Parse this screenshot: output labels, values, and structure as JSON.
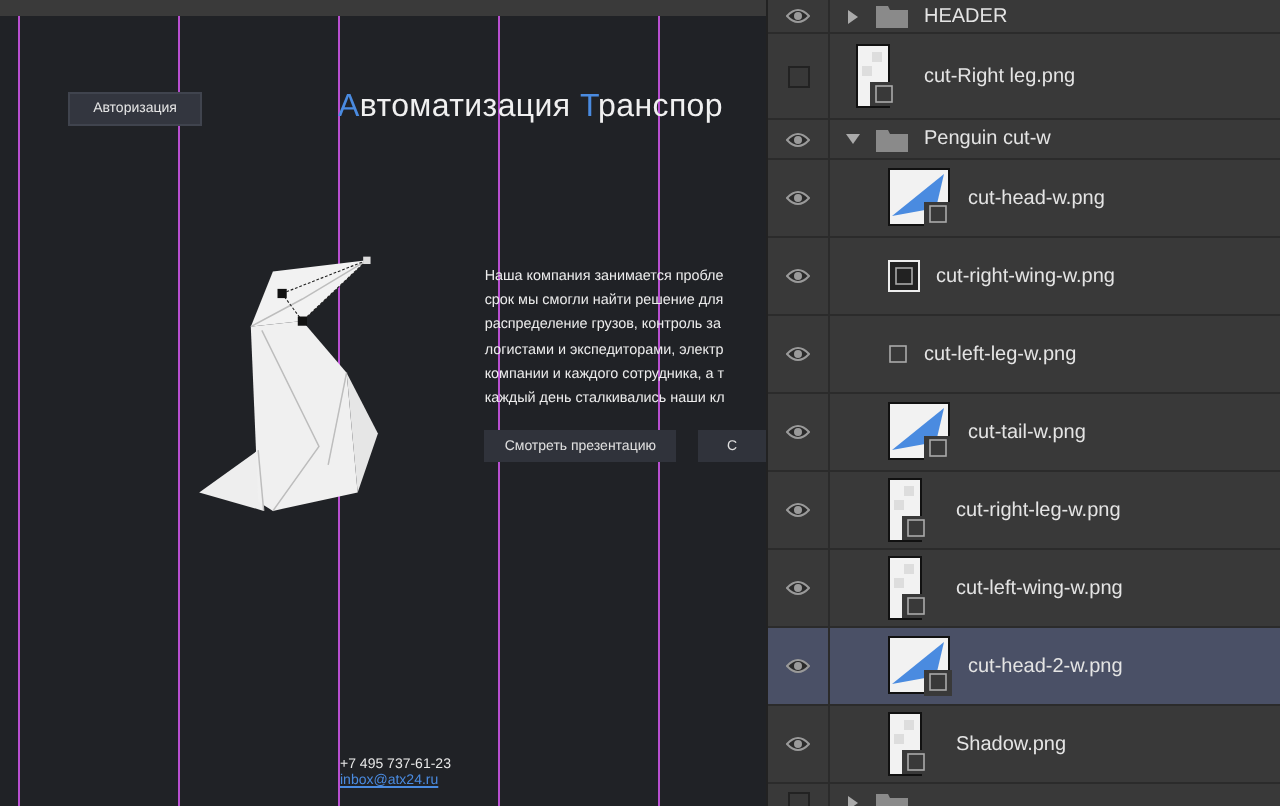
{
  "canvas": {
    "auth_button": "Авторизация",
    "heading": [
      {
        "text": "А",
        "accent": true
      },
      {
        "text": "втоматизация ",
        "accent": false
      },
      {
        "text": "Т",
        "accent": true
      },
      {
        "text": "ранспор",
        "accent": false
      }
    ],
    "paragraph_lines": [
      "Наша компания занимается пробле",
      "срок мы смогли найти решение для",
      "распределение грузов, контроль за",
      "логистами и экспедиторами, электр",
      "компании и каждого сотрудника, а т",
      "каждый день сталкивались наши кл"
    ],
    "buttons": [
      "Смотреть презентацию",
      "С"
    ],
    "phone": "+7 495 737-61-23",
    "email": "inbox@atx24.ru"
  },
  "layers": [
    {
      "kind": "folder",
      "name": "HEADER",
      "visible": true,
      "expanded": false,
      "selected": false
    },
    {
      "kind": "tall",
      "name": "cut-Right leg.png",
      "visible": false,
      "selected": false
    },
    {
      "kind": "folder",
      "name": "Penguin cut-w",
      "visible": true,
      "expanded": true,
      "selected": false,
      "children": [
        {
          "kind": "wide",
          "name": "cut-head-w.png",
          "visible": true,
          "selected": false
        },
        {
          "kind": "small",
          "name": "cut-right-wing-w.png",
          "visible": true,
          "selected": false
        },
        {
          "kind": "mask",
          "name": "cut-left-leg-w.png",
          "visible": true,
          "selected": false
        },
        {
          "kind": "wide",
          "name": "cut-tail-w.png",
          "visible": true,
          "selected": false
        },
        {
          "kind": "tall",
          "name": "cut-right-leg-w.png",
          "visible": true,
          "selected": false
        },
        {
          "kind": "tall",
          "name": "cut-left-wing-w.png",
          "visible": true,
          "selected": false
        },
        {
          "kind": "wide",
          "name": "cut-head-2-w.png",
          "visible": true,
          "selected": true
        },
        {
          "kind": "tall",
          "name": "Shadow.png",
          "visible": true,
          "selected": false
        }
      ]
    },
    {
      "kind": "folder",
      "visible": false,
      "expanded": false,
      "selected": false
    }
  ]
}
